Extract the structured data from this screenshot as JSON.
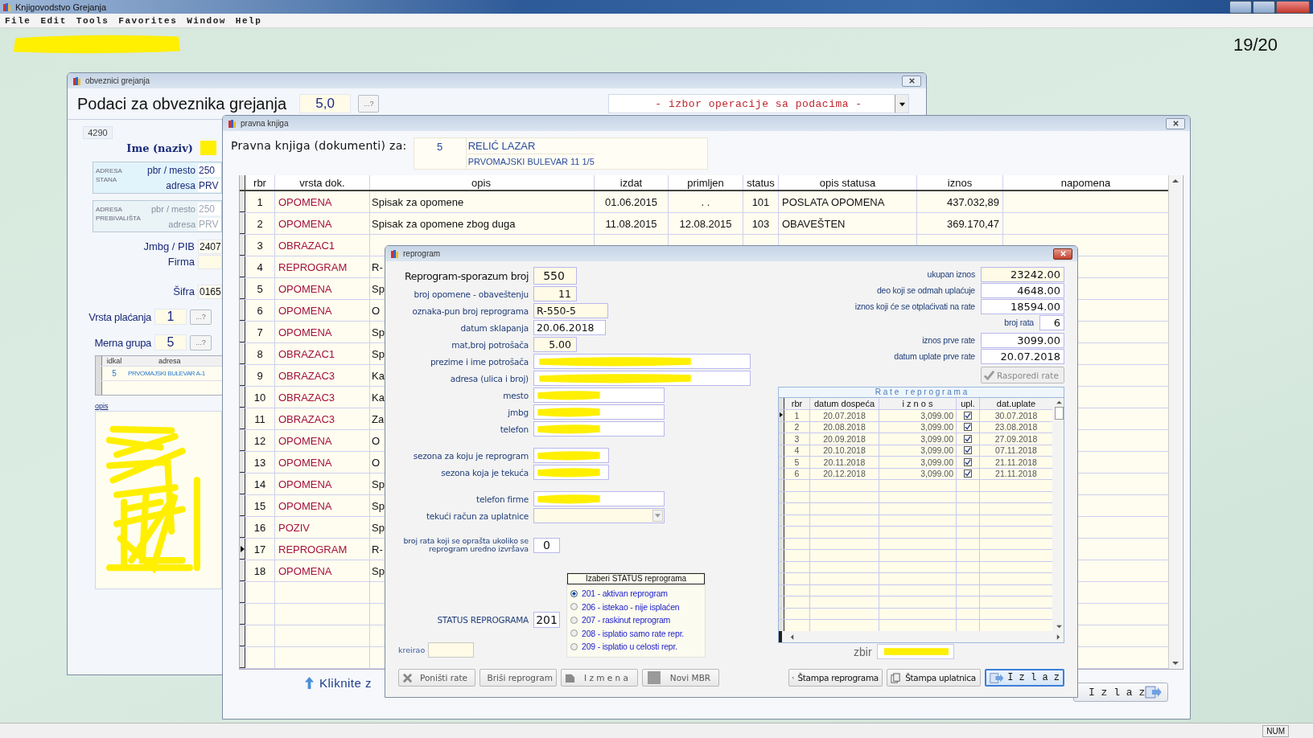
{
  "app": {
    "title": "Knjigovodstvo Grejanja",
    "menu": [
      "File",
      "Edit",
      "Tools",
      "Favorites",
      "Window",
      "Help"
    ],
    "counter": "19/20",
    "status_indicator": "NUM"
  },
  "obveznici": {
    "title": "obveznici grejanja",
    "heading": "Podaci za obveznika grejanja",
    "version": "5,0",
    "lookup": "...?",
    "operation": "- izbor operacije sa podacima -",
    "record_id": "4290",
    "name_label": "Ime (naziv)",
    "addresses": [
      {
        "caption": "ADRESA STANA",
        "active": true,
        "pbr_label": "pbr / mesto",
        "pbr": "250",
        "street_label": "adresa",
        "street": "PRV"
      },
      {
        "caption": "ADRESA PREBIVALIŠTA",
        "active": false,
        "pbr_label": "pbr / mesto",
        "pbr": "250",
        "street_label": "adresa",
        "street": "PRV"
      }
    ],
    "jmbg_label": "Jmbg / PIB",
    "jmbg": "2407",
    "firma_label": "Firma",
    "sifra_label": "Šifra",
    "sifra": "0165",
    "pickers": [
      {
        "label": "Vrsta plaćanja",
        "value": "1",
        "button": "...?"
      },
      {
        "label": "Merna grupa",
        "value": "5",
        "button": "...?"
      }
    ],
    "grid": {
      "columns": [
        "idkal",
        "adresa"
      ],
      "rows": [
        [
          "5",
          "PRVOMAJSKI BULEVAR A-1"
        ]
      ]
    },
    "opis_label": "opis"
  },
  "pravna": {
    "title": "pravna knjiga",
    "heading": "Pravna knjiga (dokumenti) za:",
    "number": "5",
    "name": "RELIĆ LAZAR",
    "address": "PRVOMAJSKI BULEVAR 11 1/5",
    "columns": [
      "rbr",
      "vrsta dok.",
      "opis",
      "izdat",
      "primljen",
      "status",
      "opis statusa",
      "iznos",
      "napomena"
    ],
    "rows": [
      {
        "current": false,
        "cells": [
          "1",
          "OPOMENA",
          "Spisak za opomene",
          "01.06.2015",
          ". .",
          "101",
          "POSLATA OPOMENA",
          "437.032,89"
        ]
      },
      {
        "current": false,
        "cells": [
          "2",
          "OPOMENA",
          "Spisak za opomene zbog duga",
          "11.08.2015",
          "12.08.2015",
          "103",
          "OBAVEŠTEN",
          "369.170,47"
        ]
      },
      {
        "current": false,
        "cells": [
          "3",
          "OBRAZAC1"
        ]
      },
      {
        "current": false,
        "cells": [
          "4",
          "REPROGRAM",
          "R-"
        ]
      },
      {
        "current": false,
        "cells": [
          "5",
          "OPOMENA",
          "Sp"
        ]
      },
      {
        "current": false,
        "cells": [
          "6",
          "OPOMENA",
          "O"
        ]
      },
      {
        "current": false,
        "cells": [
          "7",
          "OPOMENA",
          "Sp"
        ]
      },
      {
        "current": false,
        "cells": [
          "8",
          "OBRAZAC1",
          "Sp"
        ]
      },
      {
        "current": false,
        "cells": [
          "9",
          "OBRAZAC3",
          "Ka"
        ]
      },
      {
        "current": false,
        "cells": [
          "10",
          "OBRAZAC3",
          "Ka"
        ]
      },
      {
        "current": false,
        "cells": [
          "11",
          "OBRAZAC3",
          "Za"
        ]
      },
      {
        "current": false,
        "cells": [
          "12",
          "OPOMENA",
          "O"
        ]
      },
      {
        "current": false,
        "cells": [
          "13",
          "OPOMENA",
          "O"
        ]
      },
      {
        "current": false,
        "cells": [
          "14",
          "OPOMENA",
          "Sp"
        ]
      },
      {
        "current": false,
        "cells": [
          "15",
          "OPOMENA",
          "Sp"
        ]
      },
      {
        "current": false,
        "cells": [
          "16",
          "POZIV",
          "Sp"
        ]
      },
      {
        "current": true,
        "cells": [
          "17",
          "REPROGRAM",
          "R-"
        ]
      },
      {
        "current": false,
        "cells": [
          "18",
          "OPOMENA",
          "Sp"
        ]
      }
    ],
    "hint": "Kliknite z",
    "exit": "I z l a z"
  },
  "reprogram": {
    "title": "reprogram",
    "field_groups": [
      [
        {
          "label": "Reprogram-sporazum broj",
          "value": "550",
          "kind": "number",
          "emphasis": true,
          "redacted": false
        },
        {
          "label": "broj opomene - obaveštenju",
          "value": "11",
          "kind": "number",
          "emphasis": false,
          "redacted": false
        },
        {
          "label": "oznaka-pun broj reprograma",
          "value": "R-550-5",
          "kind": "code",
          "emphasis": false,
          "redacted": false
        },
        {
          "label": "datum sklapanja",
          "value": "20.06.2018",
          "kind": "date",
          "emphasis": false,
          "redacted": false
        },
        {
          "label": "mat,broj potrošača",
          "value": "5.00",
          "kind": "number",
          "emphasis": false,
          "redacted": false
        },
        {
          "label": "prezime i ime potrošača",
          "kind": "long",
          "emphasis": false,
          "redacted": true
        },
        {
          "label": "adresa (ulica i broj)",
          "kind": "long",
          "emphasis": false,
          "redacted": true
        },
        {
          "label": "mesto",
          "kind": "medium",
          "emphasis": false,
          "redacted": true
        },
        {
          "label": "jmbg",
          "kind": "medium",
          "emphasis": false,
          "redacted": true
        },
        {
          "label": "telefon",
          "kind": "medium",
          "emphasis": false,
          "redacted": true
        }
      ],
      [
        {
          "label": "sezona za koju je reprogram",
          "kind": "short",
          "emphasis": false,
          "redacted": true
        },
        {
          "label": "sezona koja je tekuća",
          "kind": "short",
          "emphasis": false,
          "redacted": true
        }
      ],
      [
        {
          "label": "telefon firme",
          "kind": "medium",
          "emphasis": false,
          "redacted": true
        },
        {
          "label": "tekući račun za uplatnice",
          "kind": "select",
          "emphasis": false,
          "redacted": false
        }
      ],
      [
        {
          "label": "broj rata koji se oprašta ukoliko se reprogram uredno izvršava",
          "value": "0",
          "kind": "count",
          "emphasis": false,
          "redacted": false
        }
      ]
    ],
    "status_label": "STATUS REPROGRAMA",
    "status_value": "201",
    "created_label": "kreirao",
    "status_group": {
      "title": "Izaberi STATUS reprograma",
      "options": [
        {
          "label": "201 - aktivan reprogram",
          "selected": true
        },
        {
          "label": "206 - istekao - nije isplaćen",
          "selected": false
        },
        {
          "label": "207 - raskinut reprogram",
          "selected": false
        },
        {
          "label": "208 - isplatio samo rate repr.",
          "selected": false
        },
        {
          "label": "209 - isplatio u celosti repr.",
          "selected": false
        }
      ]
    },
    "total_groups": [
      [
        {
          "label": "ukupan iznos",
          "value": "23242.00",
          "kind": "total"
        },
        {
          "label": "deo koji se odmah uplaćuje",
          "value": "4648.00",
          "kind": "amount"
        },
        {
          "label": "iznos koji će se otplaćivati na rate",
          "value": "18594.00",
          "kind": "amount"
        },
        {
          "label": "broj rata",
          "value": "6",
          "kind": "count"
        }
      ],
      [
        {
          "label": "iznos prve rate",
          "value": "3099.00",
          "kind": "amount"
        },
        {
          "label": "datum uplate prve rate",
          "value": "20.07.2018",
          "kind": "amount"
        }
      ]
    ],
    "distribute": {
      "label": "Rasporedi rate",
      "disabled": true
    },
    "rates": {
      "title": "R a t e   r e p r o g r a m a",
      "columns": [
        "rbr",
        "datum dospeća",
        "i z n o s",
        "upl.",
        "dat.uplate"
      ],
      "rows": [
        {
          "current": true,
          "rbr": "1",
          "due": "20.07.2018",
          "amount": "3,099.00",
          "paid": true,
          "paid_date": "30.07.2018"
        },
        {
          "current": false,
          "rbr": "2",
          "due": "20.08.2018",
          "amount": "3,099.00",
          "paid": true,
          "paid_date": "23.08.2018"
        },
        {
          "current": false,
          "rbr": "3",
          "due": "20.09.2018",
          "amount": "3,099.00",
          "paid": true,
          "paid_date": "27.09.2018"
        },
        {
          "current": false,
          "rbr": "4",
          "due": "20.10.2018",
          "amount": "3,099.00",
          "paid": true,
          "paid_date": "07.11.2018"
        },
        {
          "current": false,
          "rbr": "5",
          "due": "20.11.2018",
          "amount": "3,099.00",
          "paid": true,
          "paid_date": "21.11.2018"
        },
        {
          "current": false,
          "rbr": "6",
          "due": "20.12.2018",
          "amount": "3,099.00",
          "paid": true,
          "paid_date": "21.11.2018"
        }
      ]
    },
    "sum_label": "zbir",
    "left_buttons": [
      {
        "label": "Poništi rate",
        "kind": "cross",
        "focused": false
      },
      {
        "label": "Briši reprogram",
        "kind": "minus",
        "focused": false
      },
      {
        "label": "I z m e n a",
        "kind": "edit",
        "focused": false
      },
      {
        "label": "Novi MBR",
        "kind": "blank",
        "focused": false
      }
    ],
    "right_buttons": [
      {
        "label": "Štampa reprograma",
        "kind": "print",
        "focused": false
      },
      {
        "label": "Štampa uplatnica",
        "kind": "copy",
        "focused": false
      },
      {
        "label": "I z l a z",
        "kind": "exit",
        "focused": true
      }
    ]
  }
}
